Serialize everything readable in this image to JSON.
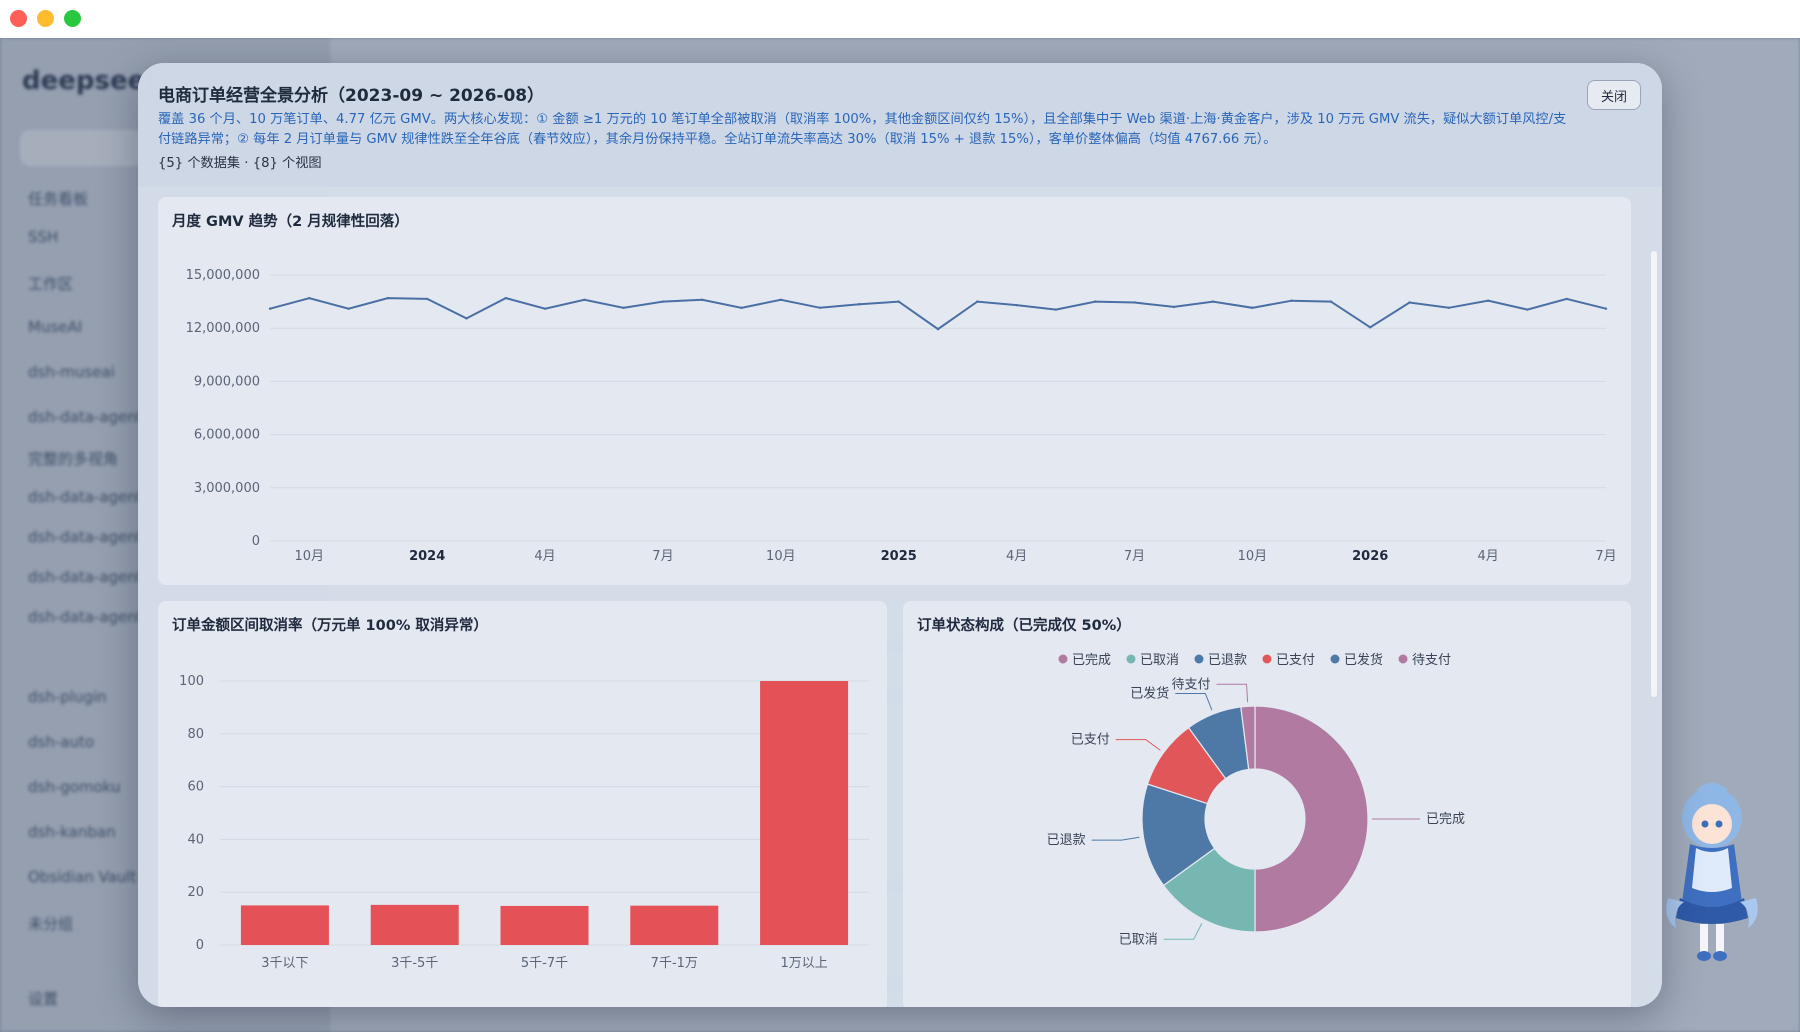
{
  "window": {
    "controls": [
      "close",
      "minimize",
      "zoom"
    ]
  },
  "background_app": {
    "logo": "deepseek",
    "sidebar": [
      "任务看板",
      "SSH",
      "工作区",
      "MuseAI",
      "dsh-museai",
      "dsh-data-agent",
      "完整的多视角",
      "dsh-data-agent",
      "dsh-data-agent",
      "dsh-data-agent",
      "dsh-data-agent",
      "dsh-plugin",
      "dsh-auto",
      "dsh-gomoku",
      "dsh-kanban",
      "Obsidian Vault",
      "未分组",
      "设置"
    ]
  },
  "modal": {
    "title": "电商订单经营全景分析（2023-09 ~ 2026-08）",
    "description": "覆盖 36 个月、10 万笔订单、4.77 亿元 GMV。两大核心发现：① 金额 ≥1 万元的 10 笔订单全部被取消（取消率 100%，其他金额区间仅约 15%），且全部集中于 Web 渠道·上海·黄金客户，涉及 10 万元 GMV 流失，疑似大额订单风控/支付链路异常；② 每年 2 月订单量与 GMV 规律性跌至全年谷底（春节效应），其余月份保持平稳。全站订单流失率高达 30%（取消 15% + 退款 15%），客单价整体偏高（均值 4767.66 元）。",
    "meta": "{5} 个数据集 · {8} 个视图",
    "close_label": "关闭"
  },
  "charts": {
    "gmv": {
      "title": "月度 GMV 趋势（2 月规律性回落）"
    },
    "cancel": {
      "title": "订单金额区间取消率（万元单 100% 取消异常）"
    },
    "status": {
      "title": "订单状态构成（已完成仅 50%）"
    }
  },
  "chart_data": [
    {
      "type": "line",
      "title": "月度 GMV 趋势（2 月规律性回落）",
      "ylim": [
        0,
        15000000
      ],
      "yticks": [
        0,
        3000000,
        6000000,
        9000000,
        12000000,
        15000000
      ],
      "ytick_labels": [
        "0",
        "3,000,000",
        "6,000,000",
        "9,000,000",
        "12,000,000",
        "15,000,000"
      ],
      "xtick_labels": [
        {
          "i": 1,
          "label": "10月",
          "bold": false
        },
        {
          "i": 4,
          "label": "2024",
          "bold": true
        },
        {
          "i": 7,
          "label": "4月",
          "bold": false
        },
        {
          "i": 10,
          "label": "7月",
          "bold": false
        },
        {
          "i": 13,
          "label": "10月",
          "bold": false
        },
        {
          "i": 16,
          "label": "2025",
          "bold": true
        },
        {
          "i": 19,
          "label": "4月",
          "bold": false
        },
        {
          "i": 22,
          "label": "7月",
          "bold": false
        },
        {
          "i": 25,
          "label": "10月",
          "bold": false
        },
        {
          "i": 28,
          "label": "2026",
          "bold": true
        },
        {
          "i": 31,
          "label": "4月",
          "bold": false
        },
        {
          "i": 34,
          "label": "7月",
          "bold": false
        }
      ],
      "values": [
        13100000,
        13700000,
        13100000,
        13700000,
        13650000,
        12550000,
        13700000,
        13100000,
        13600000,
        13150000,
        13500000,
        13600000,
        13150000,
        13600000,
        13150000,
        13350000,
        13500000,
        11950000,
        13500000,
        13300000,
        13050000,
        13500000,
        13450000,
        13200000,
        13500000,
        13150000,
        13550000,
        13500000,
        12050000,
        13450000,
        13150000,
        13550000,
        13050000,
        13650000,
        13100000
      ],
      "color": "#4a6fa5"
    },
    {
      "type": "bar",
      "title": "订单金额区间取消率（万元单 100% 取消异常）",
      "categories": [
        "3千以下",
        "3千-5千",
        "5千-7千",
        "7千-1万",
        "1万以上"
      ],
      "values": [
        15,
        15.2,
        14.8,
        14.9,
        100
      ],
      "ylim": [
        0,
        100
      ],
      "yticks": [
        0,
        20,
        40,
        60,
        80,
        100
      ],
      "color": "#e45157"
    },
    {
      "type": "pie",
      "title": "订单状态构成（已完成仅 50%）",
      "legend_position": "top",
      "series": [
        {
          "name": "已完成",
          "value": 50,
          "color": "#b07aa1"
        },
        {
          "name": "已取消",
          "value": 15,
          "color": "#76b7b2"
        },
        {
          "name": "已退款",
          "value": 15,
          "color": "#4e79a7"
        },
        {
          "name": "已支付",
          "value": 10,
          "color": "#e15759"
        },
        {
          "name": "已发货",
          "value": 8,
          "color": "#4e79a7"
        },
        {
          "name": "待支付",
          "value": 2,
          "color": "#b07aa1"
        }
      ]
    }
  ]
}
